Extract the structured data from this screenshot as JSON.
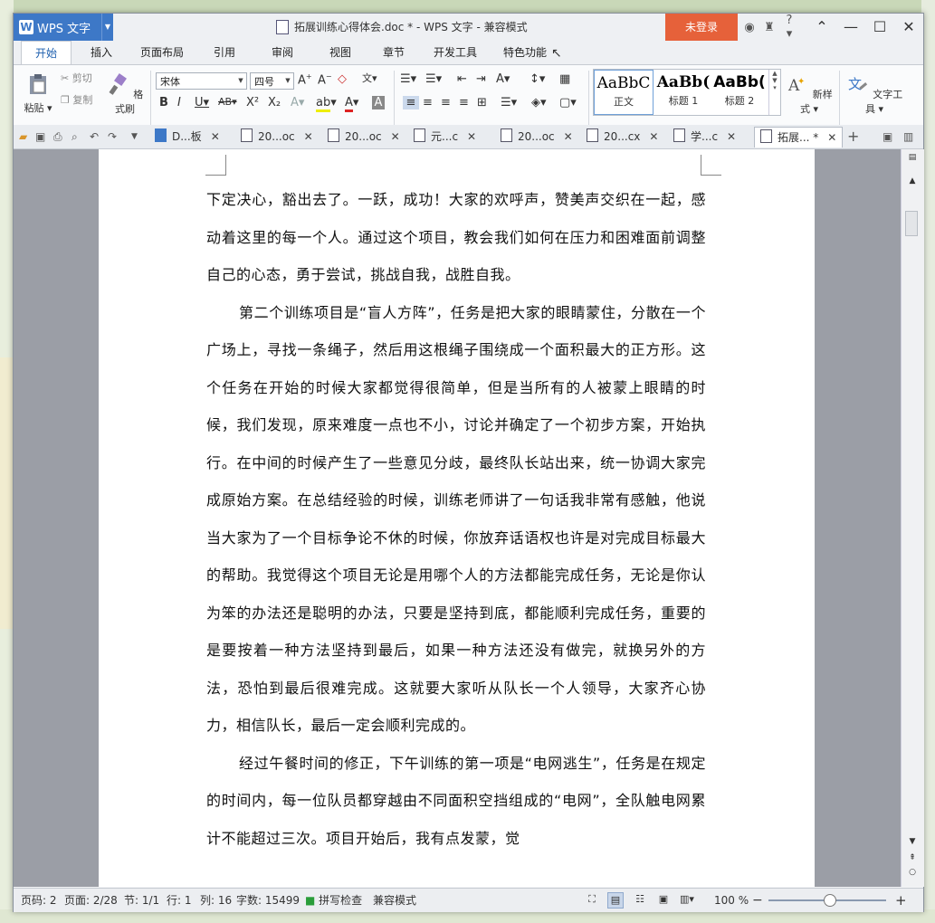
{
  "titlebar": {
    "app_name": "WPS 文字",
    "doc_title": "拓展训练心得体会.doc * - WPS 文字 - 兼容模式",
    "login_label": "未登录",
    "help_label": "?",
    "icons": [
      "skin-icon",
      "shirt-icon",
      "help-icon"
    ],
    "window_controls": [
      "minimize-icon",
      "restore-icon",
      "close-icon"
    ]
  },
  "ribbon_tabs": [
    {
      "label": "开始",
      "active": true
    },
    {
      "label": "插入"
    },
    {
      "label": "页面布局"
    },
    {
      "label": "引用"
    },
    {
      "label": "审阅"
    },
    {
      "label": "视图"
    },
    {
      "label": "章节"
    },
    {
      "label": "开发工具"
    },
    {
      "label": "特色功能"
    }
  ],
  "ribbon": {
    "paste": "粘贴",
    "cut": "剪切",
    "copy": "复制",
    "format_painter": "格式刷",
    "font_name": "宋体",
    "font_size": "四号",
    "styles": [
      {
        "sample": "AaBbC",
        "label": "正文"
      },
      {
        "sample": "AaBb(",
        "label": "标题 1"
      },
      {
        "sample": "AaBb(",
        "label": "标题 2"
      }
    ],
    "new_style": "新样式",
    "text_tools": "文字工具"
  },
  "doc_tabs": [
    {
      "label": "D...板"
    },
    {
      "label": "20...oc"
    },
    {
      "label": "20...oc"
    },
    {
      "label": "元...c"
    },
    {
      "label": "20...oc"
    },
    {
      "label": "20...cx"
    },
    {
      "label": "学...c"
    },
    {
      "label": "拓展... *",
      "active": true
    }
  ],
  "document": {
    "paragraphs": [
      {
        "indent": false,
        "text": "下定决心，豁出去了。一跃，成功！大家的欢呼声，赞美声交织在一起，感动着这里的每一个人。通过这个项目，教会我们如何在压力和困难面前调整自己的心态，勇于尝试，挑战自我，战胜自我。"
      },
      {
        "indent": true,
        "text": "第二个训练项目是“盲人方阵”，任务是把大家的眼睛蒙住，分散在一个广场上，寻找一条绳子，然后用这根绳子围绕成一个面积最大的正方形。这个任务在开始的时候大家都觉得很简单，但是当所有的人被蒙上眼睛的时候，我们发现，原来难度一点也不小，讨论并确定了一个初步方案，开始执行。在中间的时候产生了一些意见分歧，最终队长站出来，统一协调大家完成原始方案。在总结经验的时候，训练老师讲了一句话我非常有感触，他说当大家为了一个目标争论不休的时候，你放弃话语权也许是对完成目标最大的帮助。我觉得这个项目无论是用哪个人的方法都能完成任务，无论是你认为笨的办法还是聪明的办法，只要是坚持到底，都能顺利完成任务，重要的是要按着一种方法坚持到最后，如果一种方法还没有做完，就换另外的方法，恐怕到最后很难完成。这就要大家听从队长一个人领导，大家齐心协力，相信队长，最后一定会顺利完成的。"
      },
      {
        "indent": true,
        "text": "经过午餐时间的修正，下午训练的第一项是“电网逃生”，任务是在规定的时间内，每一位队员都穿越由不同面积空挡组成的“电网”，全队触电网累计不能超过三次。项目开始后，我有点发蒙，觉"
      }
    ]
  },
  "statusbar": {
    "page_code": "页码: 2",
    "page": "页面: 2/28",
    "section": "节: 1/1",
    "row": "行: 1",
    "col": "列: 16",
    "word_count": "字数: 15499",
    "spell_check": "拼写检查",
    "compat_mode": "兼容模式",
    "zoom": "100 %",
    "zoom_level": 0.5
  }
}
